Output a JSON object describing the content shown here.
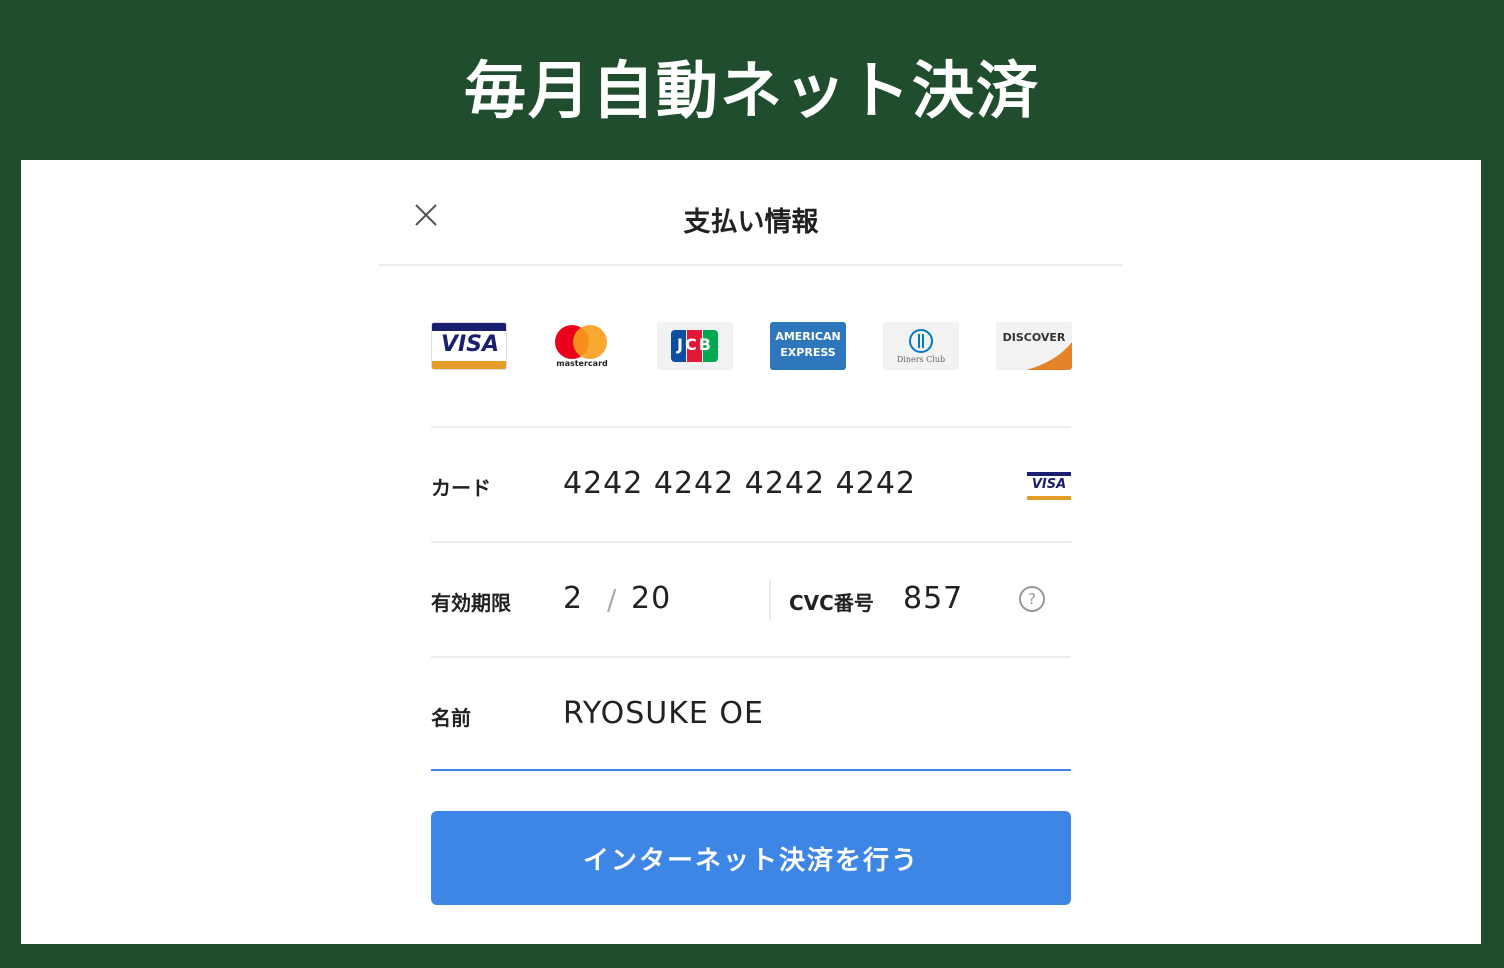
{
  "banner": {
    "title": "毎月自動ネット決済"
  },
  "modal": {
    "title": "支払い情報"
  },
  "brands": [
    {
      "name": "VISA",
      "icon": "visa-logo"
    },
    {
      "name": "mastercard",
      "icon": "mastercard-logo"
    },
    {
      "name": "JCB",
      "icon": "jcb-logo"
    },
    {
      "name": "AMERICAN EXPRESS",
      "icon": "amex-logo"
    },
    {
      "name": "Diners Club",
      "icon": "diners-club-logo"
    },
    {
      "name": "DISCOVER",
      "icon": "discover-logo"
    }
  ],
  "form": {
    "card": {
      "label": "カード",
      "value": "4242 4242 4242 4242",
      "brand_badge": "VISA"
    },
    "expiry": {
      "label": "有効期限",
      "month": "2",
      "separator": "/",
      "year": "20"
    },
    "cvc": {
      "label": "CVC番号",
      "value": "857",
      "help": "?"
    },
    "name": {
      "label": "名前",
      "value": "RYOSUKE OE"
    }
  },
  "submit": {
    "label": "インターネット決済を行う"
  },
  "colors": {
    "frame": "#1f4d2e",
    "button": "#3d86e6",
    "focus_underline": "#3d86e6",
    "visa_blue": "#1a1f71",
    "visa_orange": "#e59d2a"
  }
}
